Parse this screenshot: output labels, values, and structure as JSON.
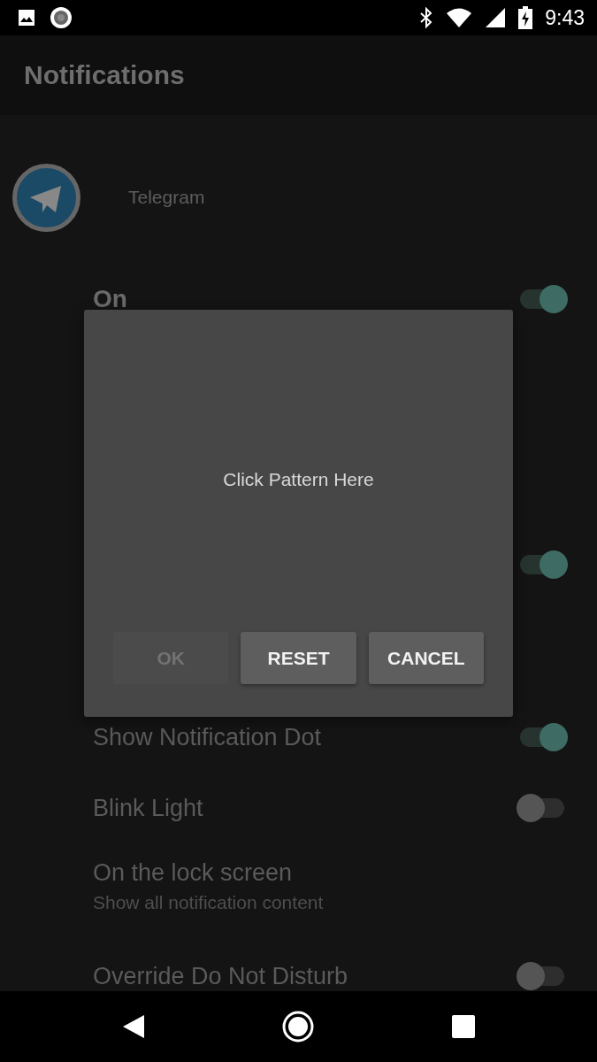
{
  "status_bar": {
    "time": "9:43"
  },
  "app_bar": {
    "title": "Notifications"
  },
  "app": {
    "name": "Telegram"
  },
  "settings": [
    {
      "kind": "master",
      "label": "On",
      "on": true
    },
    {
      "kind": "hidden",
      "on": true
    },
    {
      "kind": "toggle",
      "label": "Show Notification Dot",
      "on": true
    },
    {
      "kind": "toggle",
      "label": "Blink Light",
      "on": false
    },
    {
      "kind": "text",
      "label": "On the lock screen",
      "summary": "Show all notification content"
    },
    {
      "kind": "toggle",
      "label": "Override Do Not Disturb",
      "on": false
    }
  ],
  "dialog": {
    "message": "Click Pattern Here",
    "buttons": [
      {
        "label": "OK",
        "disabled": true
      },
      {
        "label": "RESET",
        "disabled": false
      },
      {
        "label": "CANCEL",
        "disabled": false
      }
    ]
  }
}
